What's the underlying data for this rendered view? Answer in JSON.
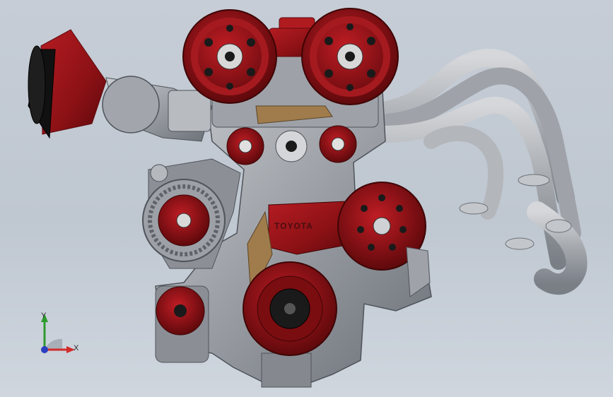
{
  "viewer": {
    "background_top": "#c6cdd6",
    "background_bottom": "#cfd6de"
  },
  "model": {
    "name": "engine-assembly",
    "brand_text": "TOYOTA",
    "colors": {
      "red": "#8e1216",
      "red_dark": "#5e0a0d",
      "metal": "#a9adb3",
      "metal_dark": "#6f747b",
      "bronze": "#a07c4c",
      "black": "#1a1a1a"
    }
  },
  "triad": {
    "x_label": "X",
    "y_label": "Y",
    "x_color": "#d22b2b",
    "y_color": "#2e9b2e",
    "z_color": "#2a3fbf"
  }
}
